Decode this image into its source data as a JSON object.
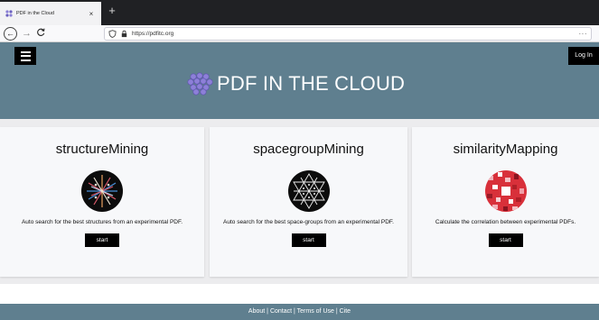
{
  "browser": {
    "tab_title": "PDF in the Cloud",
    "tab_close": "×",
    "new_tab": "+",
    "url": "https://pdfitc.org",
    "more": "···",
    "back": "←",
    "forward": "→",
    "reload": "C"
  },
  "header": {
    "menu_icon": "hamburger-icon",
    "login_label": "Log In",
    "title": "PDF IN THE CLOUD",
    "background": "#5f7f8f"
  },
  "cards": [
    {
      "title": "structureMining",
      "description": "Auto search for the best structures from an experimental PDF.",
      "button": "start",
      "image": "structure-mining-icon"
    },
    {
      "title": "spacegroupMining",
      "description": "Auto search for the best space-groups from an experimental PDF.",
      "button": "start",
      "image": "spacegroup-mining-icon"
    },
    {
      "title": "similarityMapping",
      "description": "Calculate the correlation between experimental PDFs.",
      "button": "start",
      "image": "similarity-mapping-icon"
    }
  ],
  "footer": {
    "about": "About",
    "contact": "Contact",
    "terms": "Terms of Use",
    "cite": "Cite",
    "sep": "|"
  }
}
